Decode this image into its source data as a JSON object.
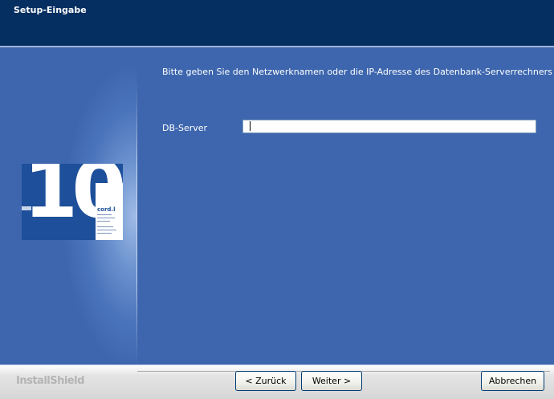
{
  "window": {
    "title": "Setup-Eingabe"
  },
  "instruction": "Bitte geben Sie den Netzwerknamen oder die IP-Adresse des Datenbank-Serverrechners an.",
  "form": {
    "db_server_label": "DB-Server",
    "db_server_value": ""
  },
  "logo": {
    "number": "10",
    "brand": "cord.l"
  },
  "footer": {
    "brand": "InstallShield",
    "back_label": "< Zurück",
    "next_label": "Weiter >",
    "cancel_label": "Abbrechen"
  },
  "colors": {
    "titlebar": "#052f61",
    "panel": "#3d66ae",
    "text": "#ffffff"
  }
}
